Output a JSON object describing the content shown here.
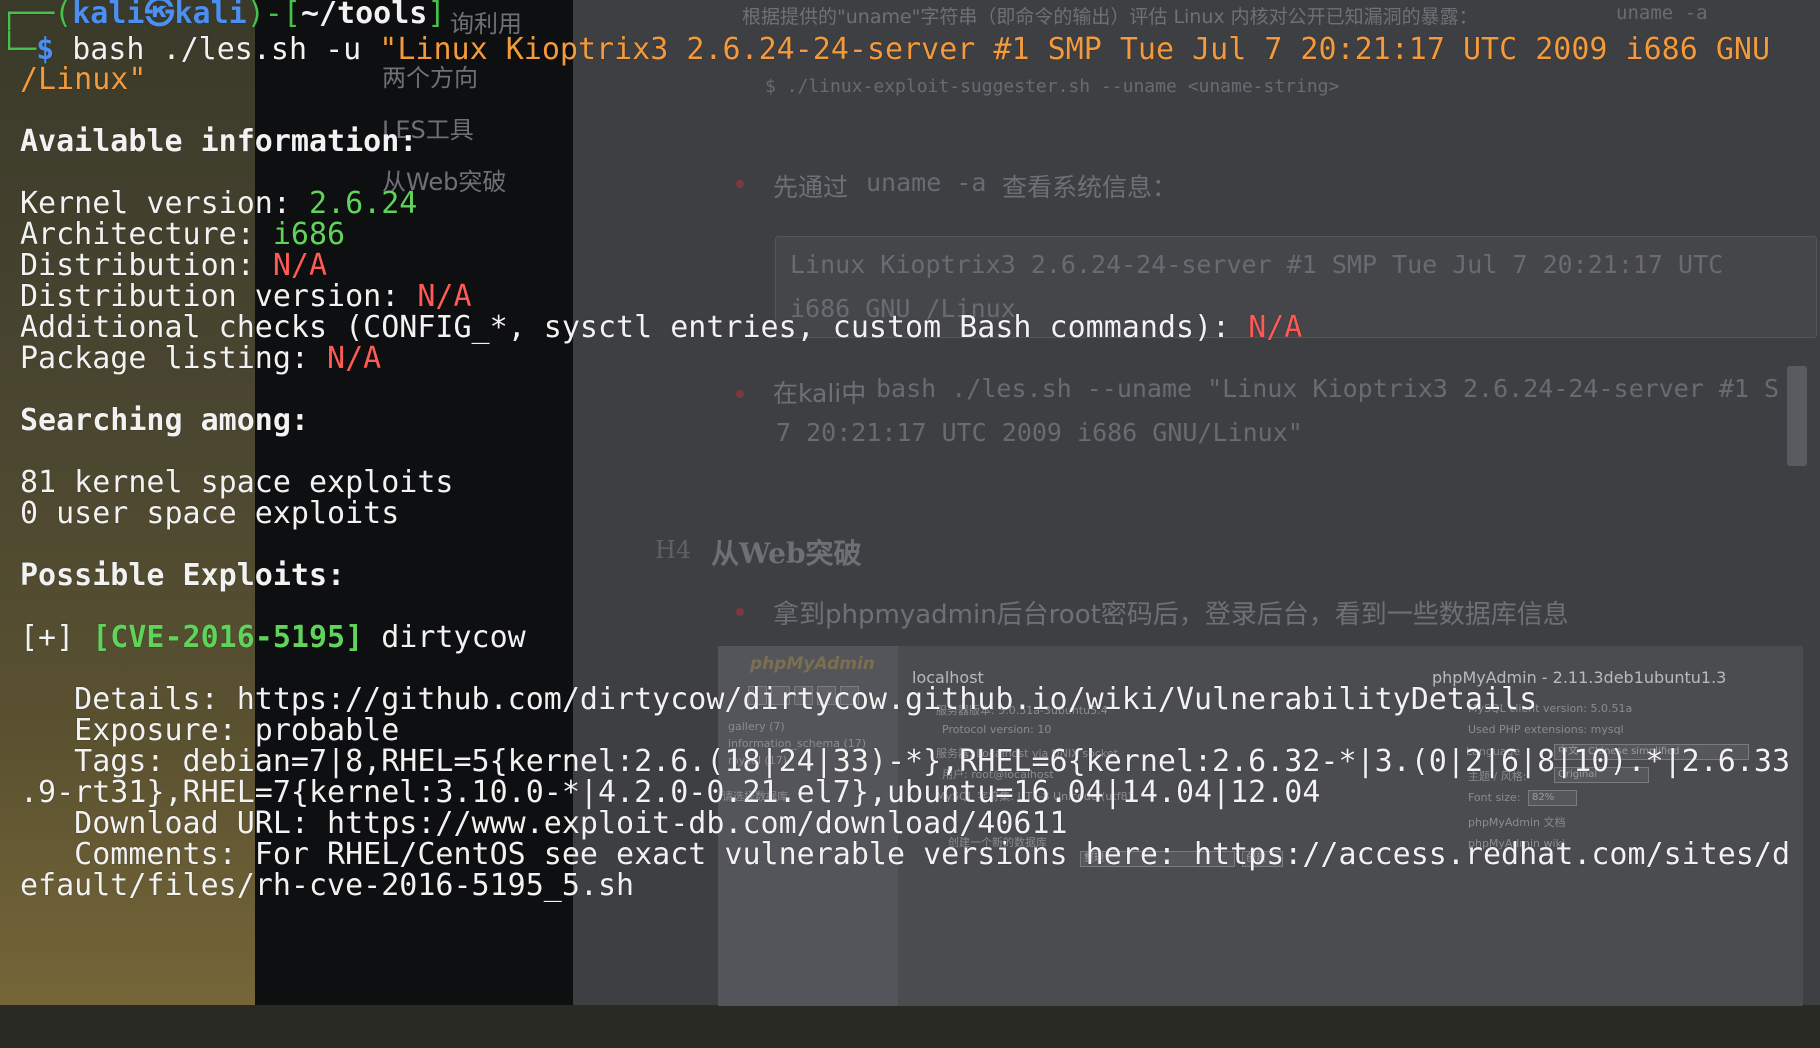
{
  "colors": {
    "terminal_text": "#f2f2f2",
    "prompt_blue": "#4c8ff0",
    "prompt_green": "#46c24a",
    "value_green": "#5fd35a",
    "value_red": "#ff5a55",
    "arg_orange": "#f39a3c",
    "doc_background": "#3e3f43"
  },
  "terminal": {
    "prompt": {
      "open": "┌──(",
      "user": "kali㉿kali",
      "mid": ")-[",
      "cwd": "~/tools",
      "close": "]",
      "line2": "└─",
      "symbol": "$",
      "command": " bash ./les.sh -u ",
      "arg_line1": "\"Linux Kioptrix3 2.6.24-24-server #1 SMP Tue Jul 7 20:21:17 UTC 2009 i686 GNU",
      "arg_line2": "/Linux\""
    },
    "available_header": "Available information:",
    "kernel_label": "Kernel version: ",
    "kernel_value": "2.6.24",
    "arch_label": "Architecture: ",
    "arch_value": "i686",
    "dist_label": "Distribution: ",
    "dist_value": "N/A",
    "distver_label": "Distribution version: ",
    "distver_value": "N/A",
    "checks_label": "Additional checks (CONFIG_*, sysctl entries, custom Bash commands): ",
    "checks_value": "N/A",
    "pkg_label": "Package listing: ",
    "pkg_value": "N/A",
    "searching_header": "Searching among:",
    "kernel_exploits": "81 kernel space exploits",
    "user_exploits": "0 user space exploits",
    "possible_header": "Possible Exploits:",
    "exploit_marker": "[+] ",
    "exploit_cve": "[CVE-2016-5195]",
    "exploit_name": " dirtycow",
    "details": "   Details: https://github.com/dirtycow/dirtycow.github.io/wiki/VulnerabilityDetails",
    "exposure": "   Exposure: probable",
    "tags_line1": "   Tags: debian=7|8,RHEL=5{kernel:2.6.(18|24|33)-*},RHEL=6{kernel:2.6.32-*|3.(0|2|6|8|10).*|2.6.33",
    "tags_line2": ".9-rt31},RHEL=7{kernel:3.10.0-*|4.2.0-0.21.el7},ubuntu=16.04|14.04|12.04",
    "download": "   Download URL: https://www.exploit-db.com/download/40611",
    "comments_line1": "   Comments: For RHEL/CentOS see exact vulnerable versions here: https://access.redhat.com/sites/d",
    "comments_line2": "efault/files/rh-cve-2016-5195_5.sh"
  },
  "background_doc": {
    "sidebar_items": [
      "询利用",
      "两个方向",
      "LES工具",
      "从Web突破"
    ],
    "top_text": "根据提供的\"uname\"字符串（即命令的输出）评估 Linux 内核对公开已知漏洞的暴露：",
    "top_code": "uname -a",
    "usage_code": "$ ./linux-exploit-suggester.sh --uname <uname-string>",
    "bullet1_pre": "先通过",
    "bullet1_code": "uname -a",
    "bullet1_post": "查看系统信息：",
    "codebox_line1": "Linux Kioptrix3 2.6.24-24-server #1 SMP Tue Jul 7 20:21:17 UTC",
    "codebox_line2": "i686 GNU /Linux",
    "bullet2_pre": "在kali中",
    "bullet2_code1": "bash ./les.sh --uname \"Linux Kioptrix3 2.6.24-24-server #1 S",
    "bullet2_code2": "7 20:21:17 UTC 2009 i686 GNU/Linux\"",
    "h4_tag": "H4",
    "h4_title": "从Web突破",
    "bullet3": "拿到phpmyadmin后台root密码后，登录后台，看到一些数据库信息",
    "pma": {
      "logo": "phpMyAdmin",
      "db_list": [
        "gallery (7)",
        "information_schema (17)",
        "mysql (17)"
      ],
      "select_db": "请选择数据库",
      "server_title": "localhost",
      "server_lines": [
        "服务器版本: 5.0.51a-3ubuntu5.4",
        "Protocol version: 10",
        "服务器: Localhost via UNIX socket",
        "用户: root@localhost",
        "MySQL 字符集: UTF-8 Unicode (utf8)"
      ],
      "create_db": "创建一个新的数据库",
      "sort_select": "整理",
      "create_btn": "创建",
      "right_title": "phpMyAdmin - 2.11.3deb1ubuntu1.3",
      "right_lines": [
        "MySQL client version: 5.0.51a",
        "Used PHP extensions: mysql"
      ],
      "language_label": "Language",
      "language_value": "中文 - Chinese simplified",
      "theme_label": "主题 / 风格:",
      "theme_value": "Original",
      "font_label": "Font size:",
      "font_value": "82%",
      "doc_link": "phpMyAdmin 文档",
      "wiki_link": "phpMyAdmin wiki"
    }
  }
}
